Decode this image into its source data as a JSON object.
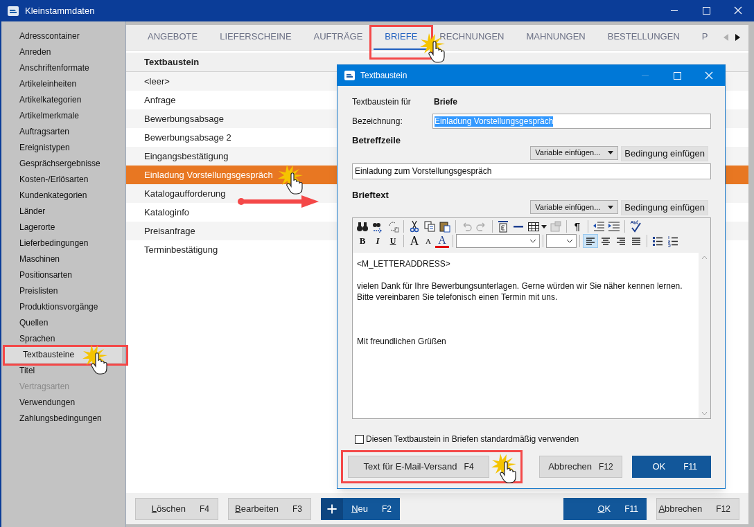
{
  "window": {
    "title": "Kleinstammdaten"
  },
  "sidebar": {
    "items": [
      {
        "label": "Adresscontainer",
        "selected": false,
        "disabled": false
      },
      {
        "label": "Anreden",
        "selected": false,
        "disabled": false
      },
      {
        "label": "Anschriftenformate",
        "selected": false,
        "disabled": false
      },
      {
        "label": "Artikeleinheiten",
        "selected": false,
        "disabled": false
      },
      {
        "label": "Artikelkategorien",
        "selected": false,
        "disabled": false
      },
      {
        "label": "Artikelmerkmale",
        "selected": false,
        "disabled": false
      },
      {
        "label": "Auftragsarten",
        "selected": false,
        "disabled": false
      },
      {
        "label": "Ereignistypen",
        "selected": false,
        "disabled": false
      },
      {
        "label": "Gesprächsergebnisse",
        "selected": false,
        "disabled": false
      },
      {
        "label": "Kosten-/Erlösarten",
        "selected": false,
        "disabled": false
      },
      {
        "label": "Kundenkategorien",
        "selected": false,
        "disabled": false
      },
      {
        "label": "Länder",
        "selected": false,
        "disabled": false
      },
      {
        "label": "Lagerorte",
        "selected": false,
        "disabled": false
      },
      {
        "label": "Lieferbedingungen",
        "selected": false,
        "disabled": false
      },
      {
        "label": "Maschinen",
        "selected": false,
        "disabled": false
      },
      {
        "label": "Positionsarten",
        "selected": false,
        "disabled": false
      },
      {
        "label": "Preislisten",
        "selected": false,
        "disabled": false
      },
      {
        "label": "Produktionsvorgänge",
        "selected": false,
        "disabled": false
      },
      {
        "label": "Quellen",
        "selected": false,
        "disabled": false
      },
      {
        "label": "Sprachen",
        "selected": false,
        "disabled": false
      },
      {
        "label": "Textbausteine",
        "selected": true,
        "disabled": false
      },
      {
        "label": "Titel",
        "selected": false,
        "disabled": false
      },
      {
        "label": "Vertragsarten",
        "selected": false,
        "disabled": true
      },
      {
        "label": "Verwendungen",
        "selected": false,
        "disabled": false
      },
      {
        "label": "Zahlungsbedingungen",
        "selected": false,
        "disabled": false
      }
    ]
  },
  "tabs": [
    {
      "label": "ANGEBOTE",
      "selected": false
    },
    {
      "label": "LIEFERSCHEINE",
      "selected": false
    },
    {
      "label": "AUFTRÄGE",
      "selected": false
    },
    {
      "label": "BRIEFE",
      "selected": true
    },
    {
      "label": "RECHNUNGEN",
      "selected": false
    },
    {
      "label": "MAHNUNGEN",
      "selected": false
    },
    {
      "label": "BESTELLUNGEN",
      "selected": false
    },
    {
      "label": "P",
      "selected": false
    }
  ],
  "table": {
    "columns": [
      "Textbaustein"
    ],
    "rows": [
      {
        "label": "<leer>",
        "selected": false
      },
      {
        "label": "Anfrage",
        "selected": false
      },
      {
        "label": "Bewerbungsabsage",
        "selected": false
      },
      {
        "label": "Bewerbungsabsage 2",
        "selected": false
      },
      {
        "label": "Eingangsbestätigung",
        "selected": false
      },
      {
        "label": "Einladung Vorstellungsgespräch",
        "selected": true
      },
      {
        "label": "Katalogaufforderung",
        "selected": false
      },
      {
        "label": "Kataloginfo",
        "selected": false
      },
      {
        "label": "Preisanfrage",
        "selected": false
      },
      {
        "label": "Terminbestätigung",
        "selected": false
      }
    ]
  },
  "bottom_buttons": [
    {
      "label": "Löschen",
      "key": "F4",
      "kind": "plain"
    },
    {
      "label": "Bearbeiten",
      "key": "F3",
      "kind": "plain"
    },
    {
      "label": "Neu",
      "key": "F2",
      "kind": "add"
    },
    {
      "label": "OK",
      "key": "F11",
      "kind": "primary"
    },
    {
      "label": "Abbrechen",
      "key": "F12",
      "kind": "plain"
    }
  ],
  "dialog": {
    "title": "Textbaustein",
    "for_label": "Textbaustein für",
    "for_value": "Briefe",
    "name_label": "Bezeichnung:",
    "name_value": "Einladung Vorstellungsgespräch",
    "subject_heading": "Betreffzeile",
    "subject_value": "Einladung zum Vorstellungsgespräch",
    "body_heading": "Brieftext",
    "variable_dropdowns": [
      "Variable einfügen...",
      "Variable einfügen..."
    ],
    "condition_buttons": [
      "Bedingung einfügen",
      "Bedingung einfügen"
    ],
    "toolbar": {
      "row1_glyphs": [
        "¶"
      ],
      "row2_glyphs": [
        "B",
        "I",
        "U",
        "A",
        "A",
        "A"
      ],
      "alignment": [
        {
          "selected": true
        },
        {
          "selected": false
        },
        {
          "selected": false
        },
        {
          "selected": false
        }
      ]
    },
    "body_paragraphs": [
      {
        "kind": "address",
        "text": "<M_LETTERADDRESS>"
      },
      {
        "kind": "paragraph",
        "text": "vielen Dank für Ihre Bewerbungsunterlagen. Gerne würden wir Sie näher kennen lernen. Bitte vereinbaren Sie telefonisch einen Termin mit uns."
      },
      {
        "kind": "closing",
        "text": "Mit freundlichen Grüßen"
      }
    ],
    "default_checkbox": {
      "label": "Diesen Textbaustein in Briefen standardmäßig verwenden",
      "checked": false
    },
    "buttons": [
      {
        "label": "Text für E-Mail-Versand",
        "key": "F4",
        "kind": "plain"
      },
      {
        "label": "Abbrechen",
        "key": "F12",
        "kind": "plain"
      },
      {
        "label": "OK",
        "key": "F11",
        "kind": "primary"
      }
    ]
  }
}
